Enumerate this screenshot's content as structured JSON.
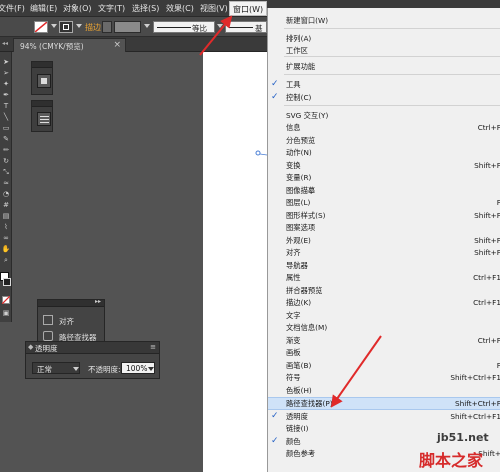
{
  "menubar": {
    "items": [
      "文件(F)",
      "编辑(E)",
      "对象(O)",
      "文字(T)",
      "选择(S)",
      "效果(C)",
      "视图(V)",
      "窗口(W)"
    ],
    "active": "窗口(W)"
  },
  "control": {
    "stroke_label": "描边",
    "profile_label": "等比",
    "brush_label": "基本"
  },
  "document_tab": {
    "title": "94% (CMYK/预览)",
    "close": "×"
  },
  "panels": {
    "align_label": "对齐",
    "pathfinder_label": "路径查找器",
    "transparency_title": "透明度",
    "blend_mode": "正常",
    "opacity_label": "不透明度:",
    "opacity_value": "100%"
  },
  "menu": {
    "items": [
      {
        "label": "新建窗口(W)",
        "shortcut": "",
        "checked": false
      },
      {
        "label": "排列(A)",
        "shortcut": "",
        "checked": false
      },
      {
        "label": "工作区",
        "shortcut": "",
        "checked": false
      },
      {
        "label": "扩展功能",
        "shortcut": "",
        "checked": false
      },
      {
        "label": "工具",
        "shortcut": "",
        "checked": true
      },
      {
        "label": "控制(C)",
        "shortcut": "",
        "checked": true
      },
      {
        "label": "SVG 交互(Y)",
        "shortcut": "",
        "checked": false
      },
      {
        "label": "信息",
        "shortcut": "Ctrl+F",
        "checked": false
      },
      {
        "label": "分色预览",
        "shortcut": "",
        "checked": false
      },
      {
        "label": "动作(N)",
        "shortcut": "",
        "checked": false
      },
      {
        "label": "变换",
        "shortcut": "Shift+F",
        "checked": false
      },
      {
        "label": "变量(R)",
        "shortcut": "",
        "checked": false
      },
      {
        "label": "图像描摹",
        "shortcut": "",
        "checked": false
      },
      {
        "label": "图层(L)",
        "shortcut": "F",
        "checked": false
      },
      {
        "label": "图形样式(S)",
        "shortcut": "Shift+F",
        "checked": false
      },
      {
        "label": "图案选项",
        "shortcut": "",
        "checked": false
      },
      {
        "label": "外观(E)",
        "shortcut": "Shift+F",
        "checked": false
      },
      {
        "label": "对齐",
        "shortcut": "Shift+F",
        "checked": false
      },
      {
        "label": "导航器",
        "shortcut": "",
        "checked": false
      },
      {
        "label": "属性",
        "shortcut": "Ctrl+F1",
        "checked": false
      },
      {
        "label": "拼合器预览",
        "shortcut": "",
        "checked": false
      },
      {
        "label": "描边(K)",
        "shortcut": "Ctrl+F1",
        "checked": false
      },
      {
        "label": "文字",
        "shortcut": "",
        "checked": false
      },
      {
        "label": "文档信息(M)",
        "shortcut": "",
        "checked": false
      },
      {
        "label": "渐变",
        "shortcut": "Ctrl+F",
        "checked": false
      },
      {
        "label": "画板",
        "shortcut": "",
        "checked": false
      },
      {
        "label": "画笔(B)",
        "shortcut": "F",
        "checked": false
      },
      {
        "label": "符号",
        "shortcut": "Shift+Ctrl+F1",
        "checked": false
      },
      {
        "label": "色板(H)",
        "shortcut": "",
        "checked": false
      },
      {
        "label": "路径查找器(P)",
        "shortcut": "Shift+Ctrl+F",
        "checked": false,
        "highlighted": true
      },
      {
        "label": "透明度",
        "shortcut": "Shift+Ctrl+F1",
        "checked": true
      },
      {
        "label": "链接(I)",
        "shortcut": "",
        "checked": false
      },
      {
        "label": "颜色",
        "shortcut": "",
        "checked": true
      },
      {
        "label": "颜色参考",
        "shortcut": "Shift+",
        "checked": false
      }
    ]
  },
  "watermark": {
    "line1": "jb51.net",
    "line2": "脚本之家"
  },
  "colors": {
    "menu_bg": "#f0f0f0",
    "highlight": "#cfe2f8",
    "check": "#2461c6",
    "arrow": "#e02a2a"
  }
}
